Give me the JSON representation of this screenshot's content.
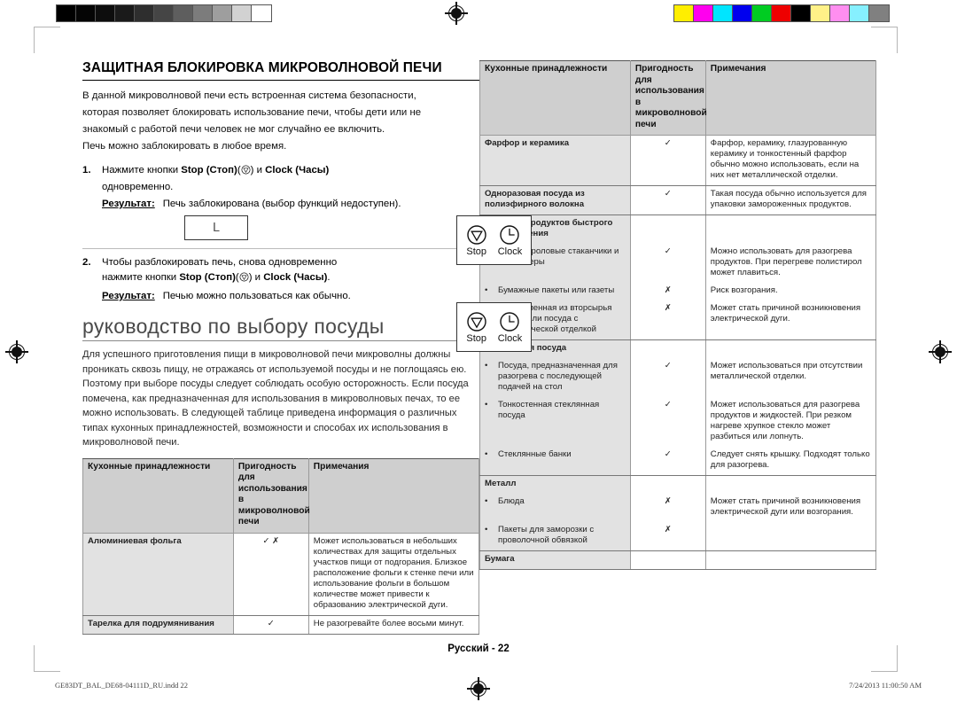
{
  "print_marks": {
    "grayscale_steps": [
      "#000000",
      "#050505",
      "#0d0d0d",
      "#1a1a1a",
      "#2e2e2e",
      "#454545",
      "#5e5e5e",
      "#7c7c7c",
      "#9e9e9e",
      "#d2d2d2",
      "#ffffff"
    ],
    "color_steps": [
      "#ffee00",
      "#ff00ee",
      "#00e5ff",
      "#0000ee",
      "#00cc22",
      "#ee0000",
      "#000000",
      "#fff188",
      "#ff8ef0",
      "#86f0ff",
      "#808080"
    ],
    "registration_mark_name": "registration-target"
  },
  "left_column": {
    "section_title": "ЗАЩИТНАЯ БЛОКИРОВКА МИКРОВОЛНОВОЙ ПЕЧИ",
    "intro_lines": [
      "В данной микроволновой печи есть встроенная система безопасности,",
      "которая позволяет блокировать использование печи, чтобы дети или не",
      "знакомый с работой печи человек не мог случайно ее включить.",
      "Печь можно заблокировать в любое время."
    ],
    "steps": [
      {
        "num": "1.",
        "text_before": "Нажмите кнопки ",
        "bold_1": "Stop (Стоп)",
        "paren_1": "(",
        "paren_1_end": ")",
        "mid": " и ",
        "bold_2": "Clock (Часы)",
        "text_after": "одновременно.",
        "result_label": "Результат:",
        "result_text": "Печь заблокирована (выбор функций недоступен).",
        "display_value": "L"
      },
      {
        "num": "2.",
        "text_before": "Чтобы разблокировать печь, снова одновременно",
        "line2_before": "нажмите кнопки ",
        "bold_1": "Stop (Стоп)",
        "paren_1": "(",
        "paren_1_end": ")",
        "mid": " и ",
        "bold_2": "Clock (Часы)",
        "dot": ".",
        "result_label": "Результат:",
        "result_text": "Печью можно пользоваться как обычно."
      }
    ],
    "keybox": {
      "stop_label": "Stop",
      "clock_label": "Clock"
    },
    "guide_title": "руководство по выбору посуды",
    "guide_body": "Для успешного приготовления пищи в микроволновой печи микроволны должны проникать сквозь пищу, не отражаясь от используемой посуды и не поглощаясь ею. Поэтому при выборе посуды следует соблюдать особую осторожность. Если посуда помечена, как предназначенная для использования в микроволновых печах, то ее можно использовать. В следующей таблице приведена информация о различных типах кухонных принадлежностей, возможности и способах их использования в микроволновой печи.",
    "table": {
      "headers": [
        "Кухонные принадлежности",
        "Пригодность для использования в микроволновой печи",
        "Примечания"
      ],
      "rows": [
        {
          "name": "Алюминиевая фольга",
          "is_group": false,
          "fit": "✓ ✗",
          "note": "Может использоваться в небольших количествах для защиты отдельных участков пищи от подгорания. Близкое расположение фольги к стенке печи или использование фольги в большом количестве может привести к образованию электрической дуги."
        },
        {
          "name": "Тарелка для подрумянивания",
          "is_group": false,
          "fit": "✓",
          "note": "Не разогревайте более восьми минут."
        }
      ]
    }
  },
  "right_column": {
    "table": {
      "headers": [
        "Кухонные принадлежности",
        "Пригодность для использования в микроволновой печи",
        "Примечания"
      ],
      "rows": [
        {
          "name": "Фарфор и керамика",
          "bullet": false,
          "group_header": false,
          "fit": "✓",
          "note": "Фарфор, керамику, глазурованную керамику и тонкостенный фарфор обычно можно использовать, если на них нет металлической отделки."
        },
        {
          "name": "Одноразовая посуда из полиэфирного волокна",
          "bullet": false,
          "group_header": false,
          "fit": "✓",
          "note": "Такая посуда обычно используется для упаковки замороженных продуктов."
        },
        {
          "name": "Упаковка продуктов быстрого приготовления",
          "bullet": false,
          "group_header": true,
          "fit": "",
          "note": ""
        },
        {
          "name": "Полистироловые стаканчики и контейнеры",
          "bullet": true,
          "group_header": false,
          "fit": "✓",
          "note": "Можно использовать для разогрева продуктов. При перегреве полистирол может плавиться."
        },
        {
          "name": "Бумажные пакеты или газеты",
          "bullet": true,
          "group_header": false,
          "fit": "✗",
          "note": "Риск возгорания."
        },
        {
          "name": "Изготовленная из вторсырья бумага или посуда с металлической отделкой",
          "bullet": true,
          "group_header": false,
          "fit": "✗",
          "note": "Может стать причиной возникновения электрической дуги."
        },
        {
          "name": "Стеклянная посуда",
          "bullet": false,
          "group_header": true,
          "fit": "",
          "note": ""
        },
        {
          "name": "Посуда, предназначенная для разогрева с последующей подачей на стол",
          "bullet": true,
          "group_header": false,
          "fit": "✓",
          "note": "Может использоваться при отсутствии металлической отделки."
        },
        {
          "name": "Тонкостенная стеклянная посуда",
          "bullet": true,
          "group_header": false,
          "fit": "✓",
          "note": "Может использоваться для разогрева продуктов и жидкостей. При резком нагреве хрупкое стекло может разбиться или лопнуть."
        },
        {
          "name": "Стеклянные банки",
          "bullet": true,
          "group_header": false,
          "fit": "✓",
          "note": "Следует снять крышку. Подходят только для разогрева."
        },
        {
          "name": "Металл",
          "bullet": false,
          "group_header": true,
          "fit": "",
          "note": ""
        },
        {
          "name": "Блюда",
          "bullet": true,
          "group_header": false,
          "fit": "✗",
          "note": "Может стать причиной возникновения электрической дуги или возгорания."
        },
        {
          "name": "Пакеты для заморозки с проволочной обвязкой",
          "bullet": true,
          "group_header": false,
          "fit": "✗",
          "note": ""
        },
        {
          "name": "Бумага",
          "bullet": false,
          "group_header": true,
          "fit": "",
          "note": ""
        }
      ]
    }
  },
  "footer": {
    "page_label": "Русский - 22"
  },
  "print_footer": {
    "filename": "GE83DT_BAL_DE68-04111D_RU.indd   22",
    "timestamp": "7/24/2013   11:00:50 AM"
  }
}
